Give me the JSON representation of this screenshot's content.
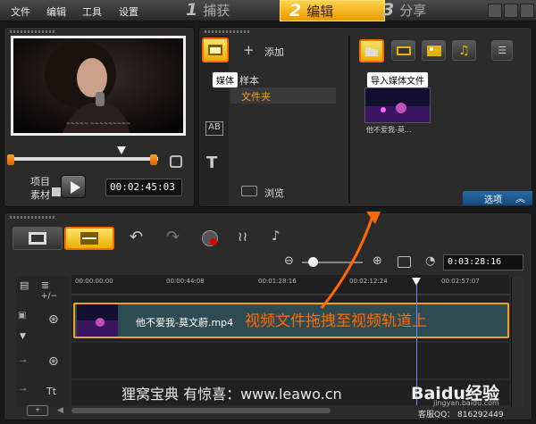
{
  "menu": {
    "file": "文件",
    "edit": "编辑",
    "tools": "工具",
    "settings": "设置"
  },
  "steps": [
    {
      "num": "1",
      "label": "捕获"
    },
    {
      "num": "2",
      "label": "编辑"
    },
    {
      "num": "3",
      "label": "分享"
    }
  ],
  "preview": {
    "project_label": "项目",
    "clip_label": "素材",
    "timecode": "00:02:45:03"
  },
  "library": {
    "add_label": "添加",
    "sample_label": "样本",
    "folder_label": "文件夹",
    "browse_label": "浏览",
    "media_tooltip": "媒体",
    "import_tooltip": "导入媒体文件",
    "thumb_caption": "他不爱我-莫...",
    "options_label": "选项"
  },
  "timeline": {
    "total_time": "0:03:28:16",
    "ruler": [
      "00:00:00:00",
      "00:00:44:08",
      "00:01:28:16",
      "00:02:12:24",
      "00:02:57:07"
    ],
    "clip_name": "他不爱我-莫文蔚.mp4",
    "annotation": "视频文件拖拽至视频轨道上",
    "plus_minus": "+/−"
  },
  "watermark": {
    "line1": "狸窝宝典  有惊喜：www.leawo.cn",
    "logo": "Baidu经验",
    "site": "jingyan.baidu.com",
    "qq": "客服QQ：  816292449"
  },
  "colors": {
    "accent": "#f0a020",
    "annotation": "#ff6a00",
    "clip": "#2f4b52"
  }
}
